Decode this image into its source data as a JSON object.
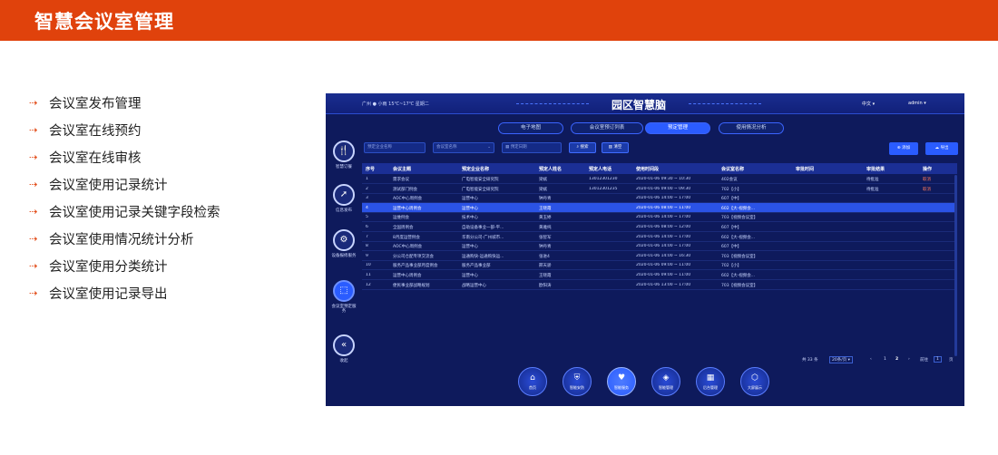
{
  "header": {
    "title": "智慧会议室管理"
  },
  "features": [
    "会议室发布管理",
    "会议室在线预约",
    "会议室在线审核",
    "会议室使用记录统计",
    "会议室使用记录关键字段检索",
    "会议室使用情况统计分析",
    "会议室使用分类统计",
    "会议室使用记录导出"
  ],
  "app": {
    "weather": "广州 ● 小雨 15℃~17℃ 星期二",
    "brand": "园区智慧脑",
    "lang": "中文 ▾",
    "user": "admin ▾",
    "tabs": [
      "电子地图",
      "会议室预订列表",
      "预定管理",
      "使用情况分析"
    ],
    "active_tab": 2,
    "side_nav": [
      "智慧订餐",
      "信息发布",
      "设备报修服务",
      "会议室预定服务",
      "收起"
    ],
    "filters": {
      "company_placeholder": "预定企业名称",
      "room_placeholder": "会议室名称",
      "date_placeholder": "预定日期",
      "search_label": "搜索",
      "clear_label": "清空",
      "add_label": "添加",
      "export_label": "导出"
    },
    "table": {
      "headers": [
        "序号",
        "会议主题",
        "预定企业名称",
        "预定人姓名",
        "预定人电话",
        "使用时间段",
        "会议室名称",
        "审批时间",
        "审批结果",
        "操作"
      ],
      "selected_row": 3,
      "rows": [
        [
          "1",
          "需求会议",
          "广电智能安全研究院",
          "梁斌",
          "13012301230",
          "2020-01-06 09:30 ~ 10:30",
          "402会议",
          "",
          "待批准",
          "取消"
        ],
        [
          "2",
          "测试部门例会",
          "广电智能安全研究院",
          "梁斌",
          "13012301235",
          "2020-01-06 09:00 ~ 09:30",
          "702【小】",
          "",
          "待批准",
          "取消"
        ],
        [
          "3",
          "AOC中心周例会",
          "运营中心",
          "钟丹青",
          "",
          "2020-01-06 14:00 ~ 17:00",
          "607【中】",
          "",
          "",
          ""
        ],
        [
          "4",
          "运营中心周例会",
          "运营中心",
          "王晓霞",
          "",
          "2020-01-06 08:00 ~ 11:00",
          "602【大-视频会...",
          "",
          "",
          ""
        ],
        [
          "5",
          "运维例会",
          "技术中心",
          "黄玉婷",
          "",
          "2020-01-06 14:00 ~ 17:00",
          "703【视频会议室】",
          "",
          "",
          ""
        ],
        [
          "6",
          "全国周例会",
          "自助设备事业一部-平...",
          "黄雅纯",
          "",
          "2020-01-06 08:00 ~ 12:00",
          "607【中】",
          "",
          "",
          ""
        ],
        [
          "7",
          "8月度运营例会",
          "华南分公司-广州城市...",
          "张智军",
          "",
          "2020-01-06 14:00 ~ 17:00",
          "602【大-视频会...",
          "",
          "",
          ""
        ],
        [
          "8",
          "AOC中心周例会",
          "运营中心",
          "钟丹青",
          "",
          "2020-01-06 14:00 ~ 17:00",
          "607【中】",
          "",
          "",
          ""
        ],
        [
          "9",
          "分公司仓配专项交流会",
          "运通购快-运通购快运...",
          "张进4",
          "",
          "2020-01-06 14:00 ~ 16:30",
          "703【视频会议室】",
          "",
          "",
          ""
        ],
        [
          "10",
          "服务产品事业部月度例会",
          "服务产品事业部",
          "邢天骄",
          "",
          "2020-01-06 09:00 ~ 11:00",
          "702【小】",
          "",
          "",
          ""
        ],
        [
          "11",
          "运营中心周例会",
          "运营中心",
          "王晓霞",
          "",
          "2020-01-06 09:00 ~ 11:00",
          "602【大-视频会...",
          "",
          "",
          ""
        ],
        [
          "12",
          "便民事业部战略规划",
          "战略运营中心",
          "欧阳涛",
          "",
          "2020-01-06 13:00 ~ 17:00",
          "703【视频会议室】",
          "",
          "",
          ""
        ]
      ]
    },
    "pager": {
      "total": "共 33 条",
      "page_size": "20条/页 ▾",
      "prev": "‹",
      "pages": [
        "1",
        "2"
      ],
      "current_page": 2,
      "next": "›",
      "goto_label": "前往",
      "goto_value": "1",
      "page_unit": "页"
    },
    "dock": [
      "首页",
      "智能安防",
      "智能服务",
      "智能管理",
      "后台管理",
      "大屏展示"
    ],
    "active_dock": 2
  }
}
